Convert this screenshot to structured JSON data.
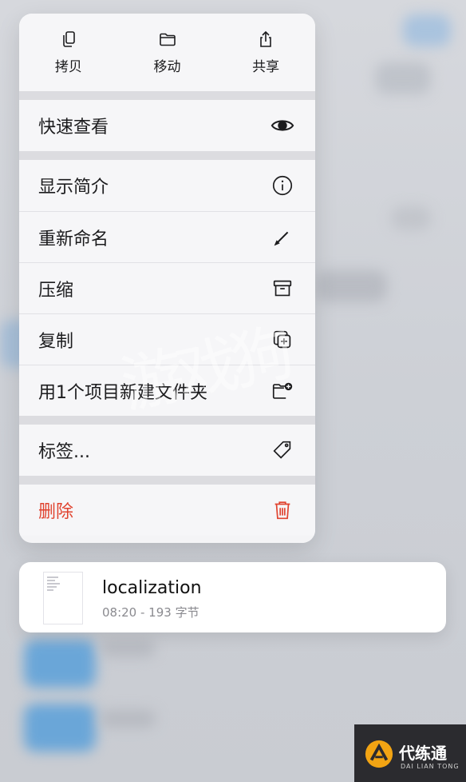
{
  "top_actions": [
    {
      "label": "拷贝",
      "icon": "copy-icon"
    },
    {
      "label": "移动",
      "icon": "folder-icon"
    },
    {
      "label": "共享",
      "icon": "share-icon"
    }
  ],
  "menu": {
    "quick_look": {
      "label": "快速查看",
      "icon": "eye-icon"
    },
    "info": {
      "label": "显示简介",
      "icon": "info-icon"
    },
    "rename": {
      "label": "重新命名",
      "icon": "pencil-icon"
    },
    "compress": {
      "label": "压缩",
      "icon": "archive-icon"
    },
    "duplicate": {
      "label": "复制",
      "icon": "duplicate-icon"
    },
    "new_folder": {
      "label": "用1个项目新建文件夹",
      "icon": "folder-badge-plus-icon"
    },
    "tags": {
      "label": "标签...",
      "icon": "tag-icon"
    },
    "delete": {
      "label": "删除",
      "icon": "trash-icon",
      "color": "#e0432f"
    }
  },
  "file": {
    "name": "localization",
    "meta": "08:20 - 193 字节"
  },
  "watermark": {
    "text": "游戏狗"
  },
  "logo": {
    "cn": "代练通",
    "en": "DAI LIAN TONG"
  }
}
